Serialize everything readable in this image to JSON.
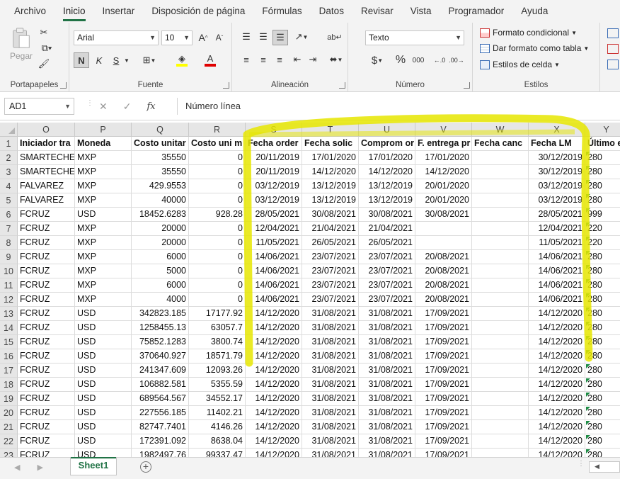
{
  "menu": [
    "Archivo",
    "Inicio",
    "Insertar",
    "Disposición de página",
    "Fórmulas",
    "Datos",
    "Revisar",
    "Vista",
    "Programador",
    "Ayuda"
  ],
  "ribbon": {
    "clipboard": {
      "paste_label": "Pegar",
      "group_label": "Portapapeles"
    },
    "font": {
      "font_name": "Arial",
      "font_size": "10",
      "group_label": "Fuente"
    },
    "alignment": {
      "group_label": "Alineación"
    },
    "number": {
      "format": "Texto",
      "group_label": "Número"
    },
    "styles": {
      "conditional": "Formato condicional",
      "as_table": "Dar formato como tabla",
      "cell_styles": "Estilos de celda",
      "group_label": "Estilos"
    }
  },
  "formula_bar": {
    "name_box": "AD1",
    "fx": "fx",
    "content": "Número línea"
  },
  "columns": [
    "O",
    "P",
    "Q",
    "R",
    "S",
    "T",
    "U",
    "V",
    "W",
    "X",
    "Y"
  ],
  "header_row": [
    "Iniciador tra",
    "Moneda",
    "Costo unitar",
    "Costo uni m",
    "Fecha order",
    "Fecha solic",
    "Comprom or",
    "F. entrega pr",
    "Fecha canc",
    "Fecha LM",
    "Último e"
  ],
  "rows": [
    [
      "SMARTECHEI",
      "MXP",
      "35550",
      "0",
      "20/11/2019",
      "17/01/2020",
      "17/01/2020",
      "17/01/2020",
      "",
      "30/12/2019",
      "280"
    ],
    [
      "SMARTECHEI",
      "MXP",
      "35550",
      "0",
      "20/11/2019",
      "14/12/2020",
      "14/12/2020",
      "14/12/2020",
      "",
      "30/12/2019",
      "280"
    ],
    [
      "FALVAREZ",
      "MXP",
      "429.9553",
      "0",
      "03/12/2019",
      "13/12/2019",
      "13/12/2019",
      "20/01/2020",
      "",
      "03/12/2019",
      "280"
    ],
    [
      "FALVAREZ",
      "MXP",
      "40000",
      "0",
      "03/12/2019",
      "13/12/2019",
      "13/12/2019",
      "20/01/2020",
      "",
      "03/12/2019",
      "280"
    ],
    [
      "FCRUZ",
      "USD",
      "18452.6283",
      "928.28",
      "28/05/2021",
      "30/08/2021",
      "30/08/2021",
      "30/08/2021",
      "",
      "28/05/2021",
      "999"
    ],
    [
      "FCRUZ",
      "MXP",
      "20000",
      "0",
      "12/04/2021",
      "21/04/2021",
      "21/04/2021",
      "",
      "",
      "12/04/2021",
      "220"
    ],
    [
      "FCRUZ",
      "MXP",
      "20000",
      "0",
      "11/05/2021",
      "26/05/2021",
      "26/05/2021",
      "",
      "",
      "11/05/2021",
      "220"
    ],
    [
      "FCRUZ",
      "MXP",
      "6000",
      "0",
      "14/06/2021",
      "23/07/2021",
      "23/07/2021",
      "20/08/2021",
      "",
      "14/06/2021",
      "280"
    ],
    [
      "FCRUZ",
      "MXP",
      "5000",
      "0",
      "14/06/2021",
      "23/07/2021",
      "23/07/2021",
      "20/08/2021",
      "",
      "14/06/2021",
      "280"
    ],
    [
      "FCRUZ",
      "MXP",
      "6000",
      "0",
      "14/06/2021",
      "23/07/2021",
      "23/07/2021",
      "20/08/2021",
      "",
      "14/06/2021",
      "280"
    ],
    [
      "FCRUZ",
      "MXP",
      "4000",
      "0",
      "14/06/2021",
      "23/07/2021",
      "23/07/2021",
      "20/08/2021",
      "",
      "14/06/2021",
      "280"
    ],
    [
      "FCRUZ",
      "USD",
      "342823.185",
      "17177.92",
      "14/12/2020",
      "31/08/2021",
      "31/08/2021",
      "17/09/2021",
      "",
      "14/12/2020",
      "280"
    ],
    [
      "FCRUZ",
      "USD",
      "1258455.13",
      "63057.7",
      "14/12/2020",
      "31/08/2021",
      "31/08/2021",
      "17/09/2021",
      "",
      "14/12/2020",
      "280"
    ],
    [
      "FCRUZ",
      "USD",
      "75852.1283",
      "3800.74",
      "14/12/2020",
      "31/08/2021",
      "31/08/2021",
      "17/09/2021",
      "",
      "14/12/2020",
      "280"
    ],
    [
      "FCRUZ",
      "USD",
      "370640.927",
      "18571.79",
      "14/12/2020",
      "31/08/2021",
      "31/08/2021",
      "17/09/2021",
      "",
      "14/12/2020",
      "280"
    ],
    [
      "FCRUZ",
      "USD",
      "241347.609",
      "12093.26",
      "14/12/2020",
      "31/08/2021",
      "31/08/2021",
      "17/09/2021",
      "",
      "14/12/2020",
      "280"
    ],
    [
      "FCRUZ",
      "USD",
      "106882.581",
      "5355.59",
      "14/12/2020",
      "31/08/2021",
      "31/08/2021",
      "17/09/2021",
      "",
      "14/12/2020",
      "280"
    ],
    [
      "FCRUZ",
      "USD",
      "689564.567",
      "34552.17",
      "14/12/2020",
      "31/08/2021",
      "31/08/2021",
      "17/09/2021",
      "",
      "14/12/2020",
      "280"
    ],
    [
      "FCRUZ",
      "USD",
      "227556.185",
      "11402.21",
      "14/12/2020",
      "31/08/2021",
      "31/08/2021",
      "17/09/2021",
      "",
      "14/12/2020",
      "280"
    ],
    [
      "FCRUZ",
      "USD",
      "82747.7401",
      "4146.26",
      "14/12/2020",
      "31/08/2021",
      "31/08/2021",
      "17/09/2021",
      "",
      "14/12/2020",
      "280"
    ],
    [
      "FCRUZ",
      "USD",
      "172391.092",
      "8638.04",
      "14/12/2020",
      "31/08/2021",
      "31/08/2021",
      "17/09/2021",
      "",
      "14/12/2020",
      "280"
    ],
    [
      "FCRUZ",
      "USD",
      "1982497.76",
      "99337.47",
      "14/12/2020",
      "31/08/2021",
      "31/08/2021",
      "17/09/2021",
      "",
      "14/12/2020",
      "280"
    ]
  ],
  "sheet_tab": "Sheet1",
  "colors": {
    "accent": "#217346",
    "highlighter": "#e6e600"
  }
}
